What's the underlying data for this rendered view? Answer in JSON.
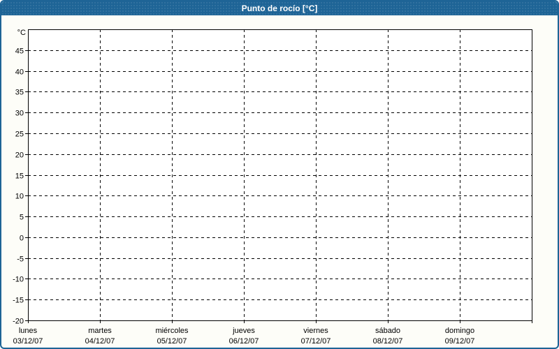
{
  "window": {
    "title": "Punto de rocío [°C]",
    "colors": {
      "frame": "#1E6496",
      "titlebar": "#1E6496",
      "titlebar_text": "#FFFFFF",
      "page_background": "#FDFDF8",
      "plot_background": "#FFFFFF",
      "plot_border": "#000000",
      "grid": "#000000",
      "text": "#000000"
    }
  },
  "chart_data": {
    "type": "line",
    "title": "Punto de rocío [°C]",
    "ylabel": "°C",
    "ylim": [
      -20,
      50
    ],
    "ytick_step": 5,
    "ytick_labels": [
      "45",
      "40",
      "35",
      "30",
      "25",
      "20",
      "15",
      "10",
      "5",
      "0",
      "-5",
      "-10",
      "-15",
      "-20"
    ],
    "grid": "dashed",
    "legend": null,
    "x_categories": [
      {
        "day": "lunes",
        "date": "03/12/07"
      },
      {
        "day": "martes",
        "date": "04/12/07"
      },
      {
        "day": "miércoles",
        "date": "05/12/07"
      },
      {
        "day": "jueves",
        "date": "06/12/07"
      },
      {
        "day": "viernes",
        "date": "07/12/07"
      },
      {
        "day": "sábado",
        "date": "08/12/07"
      },
      {
        "day": "domingo",
        "date": "09/12/07"
      }
    ],
    "series": []
  }
}
